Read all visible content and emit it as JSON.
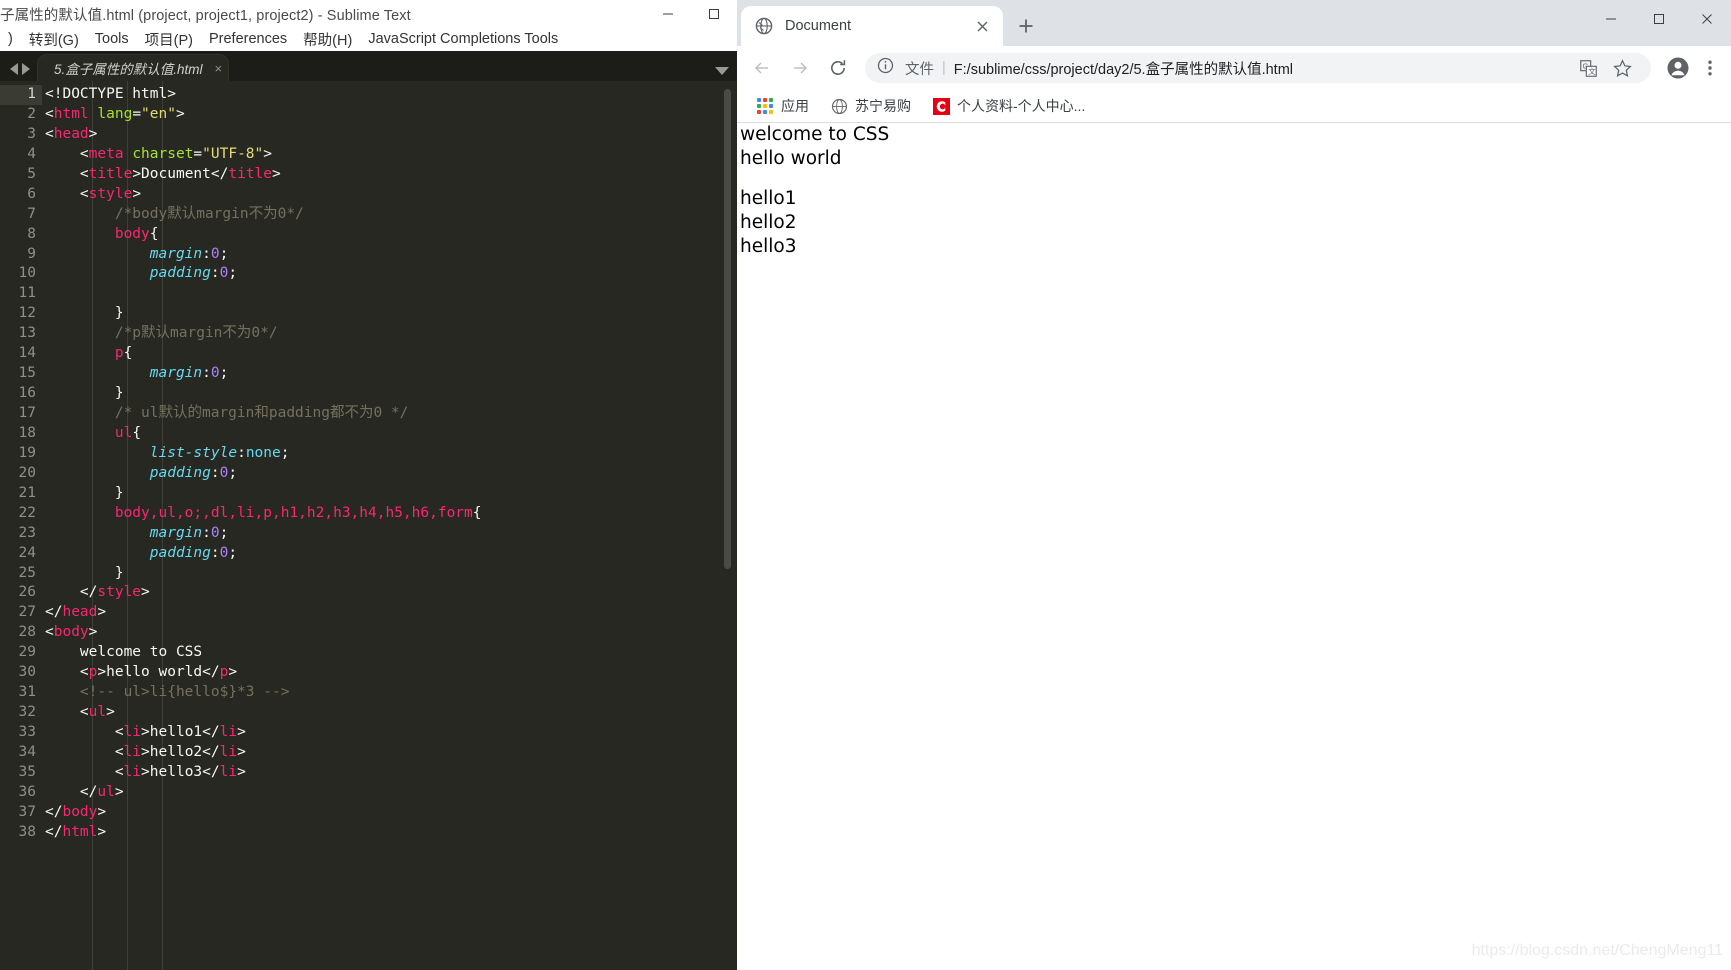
{
  "sublime": {
    "window_title": "子属性的默认值.html (project, project1, project2) - Sublime Text",
    "window_controls": [
      {
        "name": "minimize",
        "glyph": "—"
      },
      {
        "name": "maximize",
        "glyph": "□"
      }
    ],
    "menus": [
      {
        "label": ")",
        "underline": ""
      },
      {
        "label": "转到(G)",
        "underline": "G"
      },
      {
        "label": "Tools",
        "underline": "T"
      },
      {
        "label": "项目(P)",
        "underline": "P"
      },
      {
        "label": "Preferences",
        "underline": "n"
      },
      {
        "label": "帮助(H)",
        "underline": "H"
      },
      {
        "label": "JavaScript Completions Tools",
        "underline": "J"
      }
    ],
    "tab": {
      "label": "5.盒子属性的默认值.html",
      "close": "×"
    },
    "nav_prev": "◀",
    "nav_next": "▶",
    "code_lines": [
      {
        "n": 1,
        "tokens": [
          {
            "t": "punc",
            "v": "<!DOCTYPE html>"
          }
        ]
      },
      {
        "n": 2,
        "tokens": [
          {
            "t": "punc",
            "v": "<"
          },
          {
            "t": "tag",
            "v": "html"
          },
          {
            "t": "punc",
            "v": " "
          },
          {
            "t": "attr",
            "v": "lang"
          },
          {
            "t": "punc",
            "v": "="
          },
          {
            "t": "str",
            "v": "\"en\""
          },
          {
            "t": "punc",
            "v": ">"
          }
        ]
      },
      {
        "n": 3,
        "tokens": [
          {
            "t": "punc",
            "v": "<"
          },
          {
            "t": "tag",
            "v": "head"
          },
          {
            "t": "punc",
            "v": ">"
          }
        ]
      },
      {
        "n": 4,
        "tokens": [
          {
            "t": "punc",
            "v": "    <"
          },
          {
            "t": "tag",
            "v": "meta"
          },
          {
            "t": "punc",
            "v": " "
          },
          {
            "t": "attr",
            "v": "charset"
          },
          {
            "t": "punc",
            "v": "="
          },
          {
            "t": "str",
            "v": "\"UTF-8\""
          },
          {
            "t": "punc",
            "v": ">"
          }
        ]
      },
      {
        "n": 5,
        "tokens": [
          {
            "t": "punc",
            "v": "    <"
          },
          {
            "t": "tag",
            "v": "title"
          },
          {
            "t": "punc",
            "v": ">"
          },
          {
            "t": "txt",
            "v": "Document"
          },
          {
            "t": "punc",
            "v": "</"
          },
          {
            "t": "tag",
            "v": "title"
          },
          {
            "t": "punc",
            "v": ">"
          }
        ]
      },
      {
        "n": 6,
        "tokens": [
          {
            "t": "punc",
            "v": "    <"
          },
          {
            "t": "tag",
            "v": "style"
          },
          {
            "t": "punc",
            "v": ">"
          }
        ]
      },
      {
        "n": 7,
        "tokens": [
          {
            "t": "comment",
            "v": "        /*body默认margin不为0*/"
          }
        ]
      },
      {
        "n": 8,
        "tokens": [
          {
            "t": "punc",
            "v": "        "
          },
          {
            "t": "sel",
            "v": "body"
          },
          {
            "t": "punc",
            "v": "{"
          }
        ]
      },
      {
        "n": 9,
        "tokens": [
          {
            "t": "punc",
            "v": "            "
          },
          {
            "t": "prop",
            "v": "margin"
          },
          {
            "t": "punc",
            "v": ":"
          },
          {
            "t": "num",
            "v": "0"
          },
          {
            "t": "punc",
            "v": ";"
          }
        ]
      },
      {
        "n": 10,
        "tokens": [
          {
            "t": "punc",
            "v": "            "
          },
          {
            "t": "prop",
            "v": "padding"
          },
          {
            "t": "punc",
            "v": ":"
          },
          {
            "t": "num",
            "v": "0"
          },
          {
            "t": "punc",
            "v": ";"
          }
        ]
      },
      {
        "n": 11,
        "tokens": []
      },
      {
        "n": 12,
        "tokens": [
          {
            "t": "punc",
            "v": "        }"
          }
        ]
      },
      {
        "n": 13,
        "tokens": [
          {
            "t": "comment",
            "v": "        /*p默认margin不为0*/"
          }
        ]
      },
      {
        "n": 14,
        "tokens": [
          {
            "t": "punc",
            "v": "        "
          },
          {
            "t": "sel",
            "v": "p"
          },
          {
            "t": "punc",
            "v": "{"
          }
        ]
      },
      {
        "n": 15,
        "tokens": [
          {
            "t": "punc",
            "v": "            "
          },
          {
            "t": "prop",
            "v": "margin"
          },
          {
            "t": "punc",
            "v": ":"
          },
          {
            "t": "num",
            "v": "0"
          },
          {
            "t": "punc",
            "v": ";"
          }
        ]
      },
      {
        "n": 16,
        "tokens": [
          {
            "t": "punc",
            "v": "        }"
          }
        ]
      },
      {
        "n": 17,
        "tokens": [
          {
            "t": "comment",
            "v": "        /* ul默认的margin和padding都不为0 */"
          }
        ]
      },
      {
        "n": 18,
        "tokens": [
          {
            "t": "punc",
            "v": "        "
          },
          {
            "t": "sel",
            "v": "ul"
          },
          {
            "t": "punc",
            "v": "{"
          }
        ]
      },
      {
        "n": 19,
        "tokens": [
          {
            "t": "punc",
            "v": "            "
          },
          {
            "t": "prop",
            "v": "list-style"
          },
          {
            "t": "punc",
            "v": ":"
          },
          {
            "t": "val",
            "v": "none"
          },
          {
            "t": "punc",
            "v": ";"
          }
        ]
      },
      {
        "n": 20,
        "tokens": [
          {
            "t": "punc",
            "v": "            "
          },
          {
            "t": "prop",
            "v": "padding"
          },
          {
            "t": "punc",
            "v": ":"
          },
          {
            "t": "num",
            "v": "0"
          },
          {
            "t": "punc",
            "v": ";"
          }
        ]
      },
      {
        "n": 21,
        "tokens": [
          {
            "t": "punc",
            "v": "        }"
          }
        ]
      },
      {
        "n": 22,
        "tokens": [
          {
            "t": "punc",
            "v": "        "
          },
          {
            "t": "sel",
            "v": "body,ul,o;,dl,li,p,h1,h2,h3,h4,h5,h6,form"
          },
          {
            "t": "punc",
            "v": "{"
          }
        ]
      },
      {
        "n": 23,
        "tokens": [
          {
            "t": "punc",
            "v": "            "
          },
          {
            "t": "prop",
            "v": "margin"
          },
          {
            "t": "punc",
            "v": ":"
          },
          {
            "t": "num",
            "v": "0"
          },
          {
            "t": "punc",
            "v": ";"
          }
        ]
      },
      {
        "n": 24,
        "tokens": [
          {
            "t": "punc",
            "v": "            "
          },
          {
            "t": "prop",
            "v": "padding"
          },
          {
            "t": "punc",
            "v": ":"
          },
          {
            "t": "num",
            "v": "0"
          },
          {
            "t": "punc",
            "v": ";"
          }
        ]
      },
      {
        "n": 25,
        "tokens": [
          {
            "t": "punc",
            "v": "        }"
          }
        ]
      },
      {
        "n": 26,
        "tokens": [
          {
            "t": "punc",
            "v": "    </"
          },
          {
            "t": "tag",
            "v": "style"
          },
          {
            "t": "punc",
            "v": ">"
          }
        ]
      },
      {
        "n": 27,
        "tokens": [
          {
            "t": "punc",
            "v": "</"
          },
          {
            "t": "tag",
            "v": "head"
          },
          {
            "t": "punc",
            "v": ">"
          }
        ]
      },
      {
        "n": 28,
        "tokens": [
          {
            "t": "punc",
            "v": "<"
          },
          {
            "t": "tag",
            "v": "body"
          },
          {
            "t": "punc",
            "v": ">"
          }
        ]
      },
      {
        "n": 29,
        "tokens": [
          {
            "t": "txt",
            "v": "    welcome to CSS"
          }
        ]
      },
      {
        "n": 30,
        "tokens": [
          {
            "t": "punc",
            "v": "    <"
          },
          {
            "t": "tag",
            "v": "p"
          },
          {
            "t": "punc",
            "v": ">"
          },
          {
            "t": "txt",
            "v": "hello world"
          },
          {
            "t": "punc",
            "v": "</"
          },
          {
            "t": "tag",
            "v": "p"
          },
          {
            "t": "punc",
            "v": ">"
          }
        ]
      },
      {
        "n": 31,
        "tokens": [
          {
            "t": "comment",
            "v": "    <!-- ul>li{hello$}*3 -->"
          }
        ]
      },
      {
        "n": 32,
        "tokens": [
          {
            "t": "punc",
            "v": "    <"
          },
          {
            "t": "tag",
            "v": "ul"
          },
          {
            "t": "punc",
            "v": ">"
          }
        ]
      },
      {
        "n": 33,
        "tokens": [
          {
            "t": "punc",
            "v": "        <"
          },
          {
            "t": "tag",
            "v": "li"
          },
          {
            "t": "punc",
            "v": ">"
          },
          {
            "t": "txt",
            "v": "hello1"
          },
          {
            "t": "punc",
            "v": "</"
          },
          {
            "t": "tag",
            "v": "li"
          },
          {
            "t": "punc",
            "v": ">"
          }
        ]
      },
      {
        "n": 34,
        "tokens": [
          {
            "t": "punc",
            "v": "        <"
          },
          {
            "t": "tag",
            "v": "li"
          },
          {
            "t": "punc",
            "v": ">"
          },
          {
            "t": "txt",
            "v": "hello2"
          },
          {
            "t": "punc",
            "v": "</"
          },
          {
            "t": "tag",
            "v": "li"
          },
          {
            "t": "punc",
            "v": ">"
          }
        ]
      },
      {
        "n": 35,
        "tokens": [
          {
            "t": "punc",
            "v": "        <"
          },
          {
            "t": "tag",
            "v": "li"
          },
          {
            "t": "punc",
            "v": ">"
          },
          {
            "t": "txt",
            "v": "hello3"
          },
          {
            "t": "punc",
            "v": "</"
          },
          {
            "t": "tag",
            "v": "li"
          },
          {
            "t": "punc",
            "v": ">"
          }
        ]
      },
      {
        "n": 36,
        "tokens": [
          {
            "t": "punc",
            "v": "    </"
          },
          {
            "t": "tag",
            "v": "ul"
          },
          {
            "t": "punc",
            "v": ">"
          }
        ]
      },
      {
        "n": 37,
        "tokens": [
          {
            "t": "punc",
            "v": "</"
          },
          {
            "t": "tag",
            "v": "body"
          },
          {
            "t": "punc",
            "v": ">"
          }
        ]
      },
      {
        "n": 38,
        "tokens": [
          {
            "t": "punc",
            "v": "</"
          },
          {
            "t": "tag",
            "v": "html"
          },
          {
            "t": "punc",
            "v": ">"
          }
        ]
      }
    ]
  },
  "chrome": {
    "tab": {
      "title": "Document",
      "favicon": "globe-icon",
      "close": "×"
    },
    "new_tab_label": "+",
    "window_controls": [
      {
        "name": "minimize",
        "glyph": "—"
      },
      {
        "name": "maximize",
        "glyph": "□"
      },
      {
        "name": "close",
        "glyph": "×"
      }
    ],
    "nav": {
      "back": "back-arrow-icon",
      "forward": "forward-arrow-icon",
      "reload": "reload-icon"
    },
    "omnibox": {
      "info_icon": "info-circle-icon",
      "scheme_label": "文件",
      "separator": "|",
      "url": "F:/sublime/css/project/day2/5.盒子属性的默认值.html",
      "translate_icon": "translate-icon",
      "bookmark_icon": "star-icon"
    },
    "profile_icon": "profile-avatar-icon",
    "menu_icon": "three-dot-menu-icon",
    "bookmarks": [
      {
        "label": "应用",
        "icon": "apps-grid-icon"
      },
      {
        "label": "苏宁易购",
        "icon": "globe-icon"
      },
      {
        "label": "个人资料-个人中心...",
        "icon": "red-c-icon"
      }
    ],
    "page": {
      "line1": "welcome to CSS",
      "line2": "hello world",
      "items": [
        "hello1",
        "hello2",
        "hello3"
      ]
    },
    "watermark": "https://blog.csdn.net/ChengMeng11"
  },
  "colors": {
    "editor_bg": "#272822",
    "tag": "#f92672",
    "string": "#e6db74",
    "attribute": "#a6e22e",
    "comment": "#75715e",
    "property": "#66d9ef",
    "number": "#ae81ff",
    "chrome_tabstrip": "#dee1e6",
    "bookmark_red": "#e60012"
  }
}
